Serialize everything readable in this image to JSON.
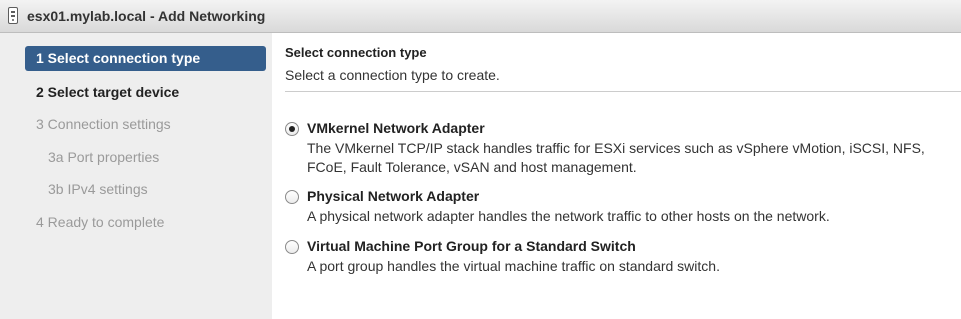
{
  "window": {
    "title": "esx01.mylab.local - Add Networking",
    "icon": "device-icon"
  },
  "steps": [
    {
      "label": "1  Select connection type",
      "state": "active"
    },
    {
      "label": "2  Select target device",
      "state": "current"
    },
    {
      "label": "3  Connection settings",
      "state": "disabled"
    },
    {
      "label": "3a  Port properties",
      "state": "disabled"
    },
    {
      "label": "3b  IPv4 settings",
      "state": "disabled"
    },
    {
      "label": "4  Ready to complete",
      "state": "disabled"
    }
  ],
  "content": {
    "title": "Select connection type",
    "subtitle": "Select a connection type to create.",
    "options": [
      {
        "label": "VMkernel Network Adapter",
        "description": "The VMkernel TCP/IP stack handles traffic for ESXi services such as vSphere vMotion, iSCSI, NFS, FCoE, Fault Tolerance, vSAN and host management.",
        "selected": true
      },
      {
        "label": "Physical Network Adapter",
        "description": "A physical network adapter handles the network traffic to other hosts on the network.",
        "selected": false
      },
      {
        "label": "Virtual Machine Port Group for a Standard Switch",
        "description": "A port group handles the virtual machine traffic on standard switch.",
        "selected": false
      }
    ]
  },
  "colors": {
    "active_step_bg": "#355e8c",
    "steps_panel_bg": "#eeeeee",
    "disabled_text": "#9a9a9a"
  }
}
